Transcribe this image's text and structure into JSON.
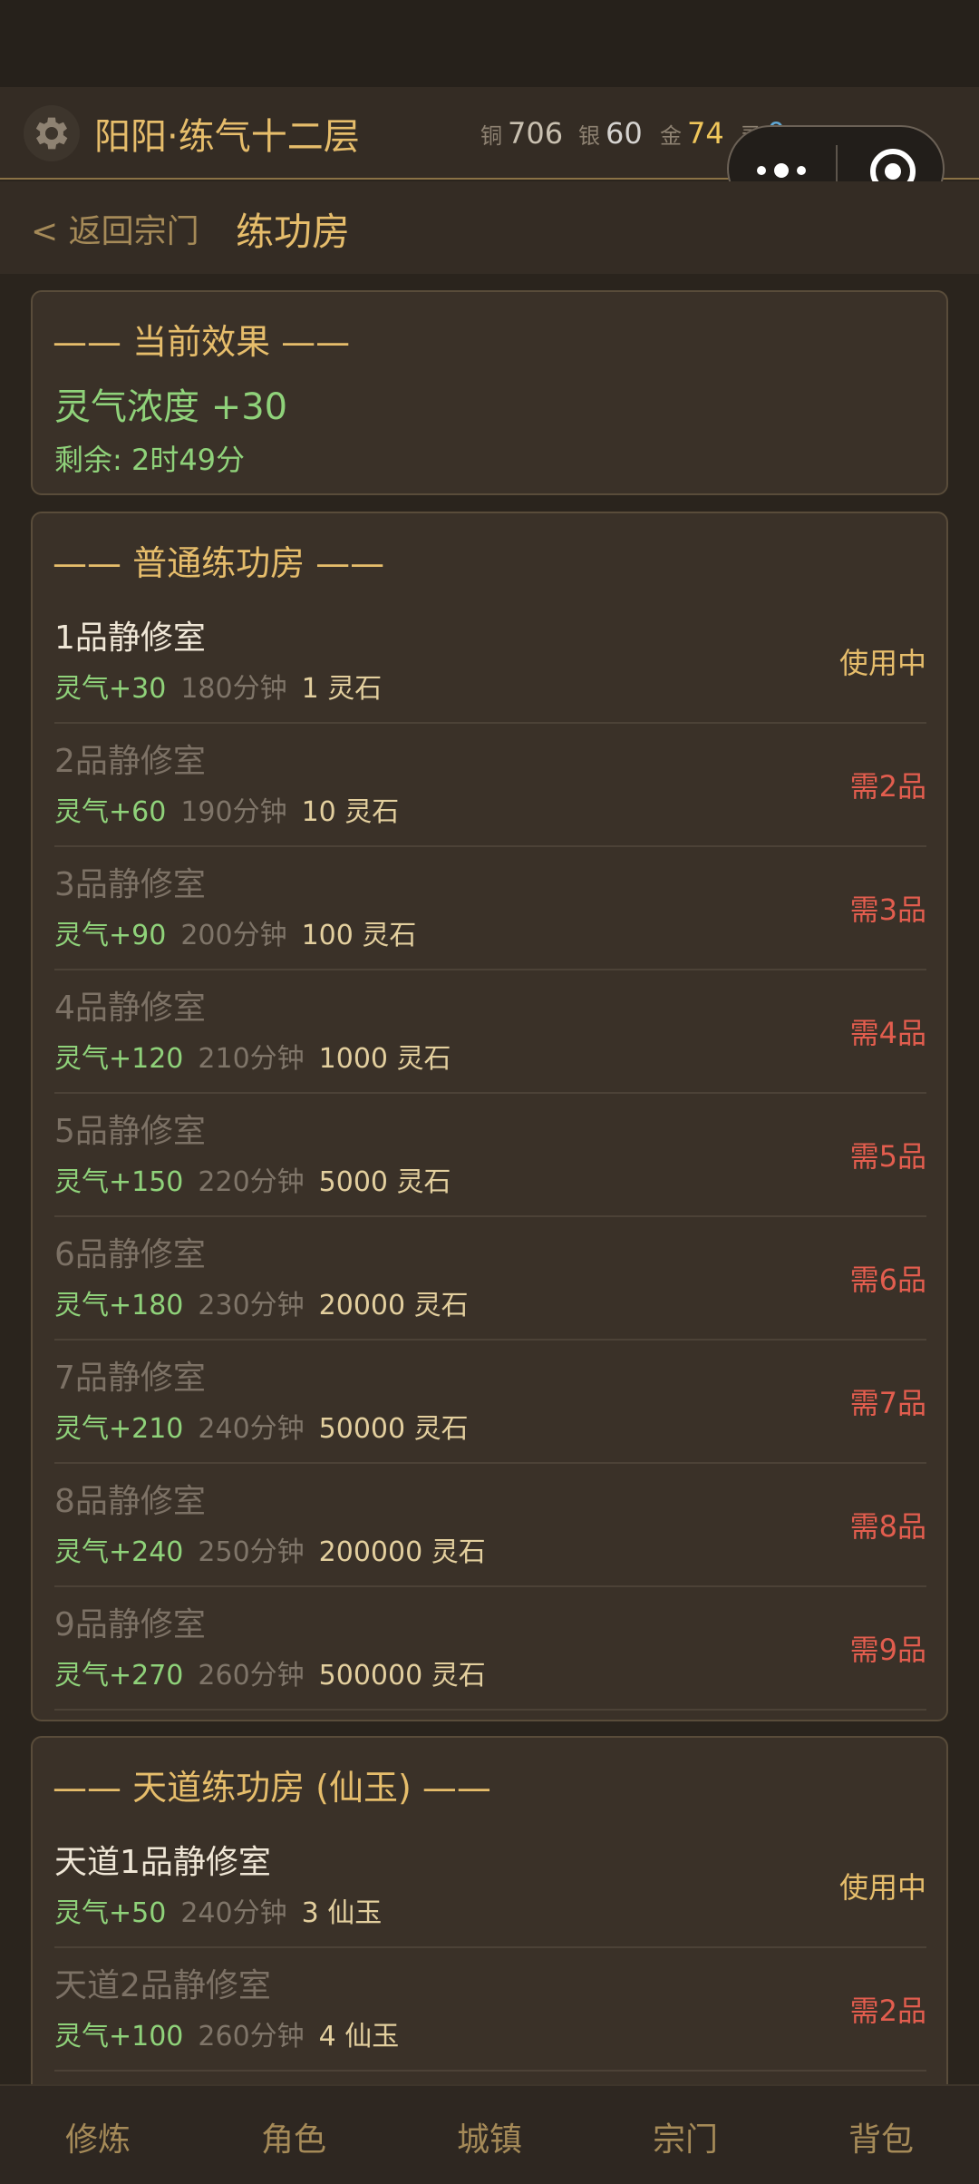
{
  "header": {
    "player_name": "阳阳·练气十二层",
    "currencies": [
      {
        "label": "铜",
        "value": "706"
      },
      {
        "label": "银",
        "value": "60"
      },
      {
        "label": "金",
        "value": "74"
      },
      {
        "label": "灵",
        "value": "0"
      }
    ]
  },
  "nav": {
    "back": "< 返回宗门",
    "title": "练功房"
  },
  "effect": {
    "title": "—— 当前效果 ——",
    "main": "灵气浓度 +30",
    "remaining": "剩余: 2时49分"
  },
  "normal": {
    "title": "—— 普通练功房 ——",
    "rooms": [
      {
        "name": "1品静修室",
        "qi": "灵气+30",
        "duration": "180分钟",
        "cost": "1 灵石",
        "status": "使用中"
      },
      {
        "name": "2品静修室",
        "qi": "灵气+60",
        "duration": "190分钟",
        "cost": "10 灵石",
        "status": "需2品"
      },
      {
        "name": "3品静修室",
        "qi": "灵气+90",
        "duration": "200分钟",
        "cost": "100 灵石",
        "status": "需3品"
      },
      {
        "name": "4品静修室",
        "qi": "灵气+120",
        "duration": "210分钟",
        "cost": "1000 灵石",
        "status": "需4品"
      },
      {
        "name": "5品静修室",
        "qi": "灵气+150",
        "duration": "220分钟",
        "cost": "5000 灵石",
        "status": "需5品"
      },
      {
        "name": "6品静修室",
        "qi": "灵气+180",
        "duration": "230分钟",
        "cost": "20000 灵石",
        "status": "需6品"
      },
      {
        "name": "7品静修室",
        "qi": "灵气+210",
        "duration": "240分钟",
        "cost": "50000 灵石",
        "status": "需7品"
      },
      {
        "name": "8品静修室",
        "qi": "灵气+240",
        "duration": "250分钟",
        "cost": "200000 灵石",
        "status": "需8品"
      },
      {
        "name": "9品静修室",
        "qi": "灵气+270",
        "duration": "260分钟",
        "cost": "500000 灵石",
        "status": "需9品"
      }
    ]
  },
  "heaven": {
    "title": "—— 天道练功房 (仙玉) ——",
    "rooms": [
      {
        "name": "天道1品静修室",
        "qi": "灵气+50",
        "duration": "240分钟",
        "cost": "3 仙玉",
        "status": "使用中"
      },
      {
        "name": "天道2品静修室",
        "qi": "灵气+100",
        "duration": "260分钟",
        "cost": "4 仙玉",
        "status": "需2品"
      }
    ]
  },
  "bottom_nav": [
    "修炼",
    "角色",
    "城镇",
    "宗门",
    "背包"
  ]
}
